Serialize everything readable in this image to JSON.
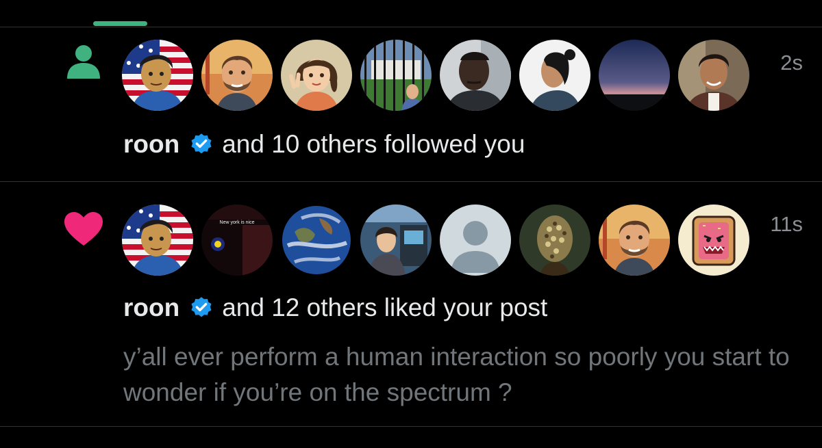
{
  "header": {
    "active_tab_accent": "#3fb27f"
  },
  "colors": {
    "follow_icon": "#3fb27f",
    "like_icon": "#f0287a",
    "verified": "#1d9bf0"
  },
  "notifications": [
    {
      "type": "follow",
      "icon": "person-icon",
      "time": "2s",
      "user": "roon",
      "verified": true,
      "text": "and 10 others followed you",
      "avatars": [
        "cartoon-boy-flag",
        "cartoon-man-bridge",
        "cartoon-girl-peace",
        "man-at-fence",
        "man-selfie",
        "man-profile-bun",
        "twilight-sky",
        "man-smiling"
      ]
    },
    {
      "type": "like",
      "icon": "heart-icon",
      "time": "11s",
      "user": "roon",
      "verified": true,
      "text": "and 12 others liked your post",
      "avatar_caption": "New york is nice",
      "post": "y’all ever perform a human interaction so poorly you start to wonder if you’re on the spectrum ?",
      "avatars": [
        "cartoon-boy-flag",
        "dark-scene-caption",
        "earth",
        "anime-arcade",
        "default-avatar",
        "jeweled-head",
        "cartoon-man-bridge",
        "pop-tart-monster"
      ]
    }
  ]
}
